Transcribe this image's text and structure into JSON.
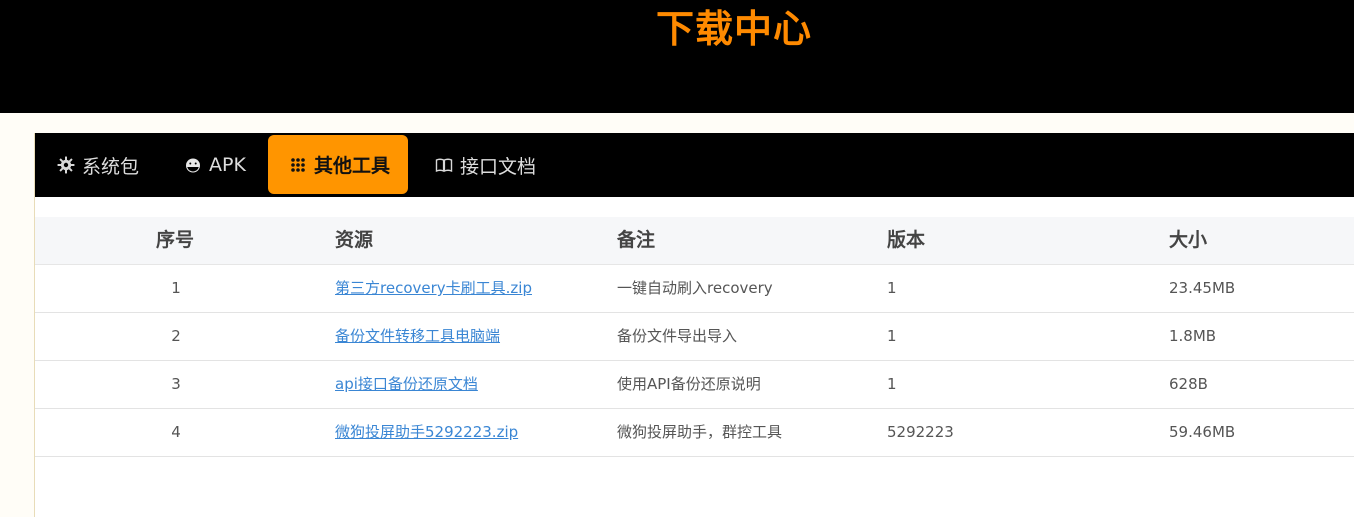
{
  "header": {
    "title": "下载中心"
  },
  "tabs": [
    {
      "label": "系统包",
      "icon": "gear-icon",
      "active": false
    },
    {
      "label": "APK",
      "icon": "android-icon",
      "active": false
    },
    {
      "label": "其他工具",
      "icon": "grid-dots-icon",
      "active": true
    },
    {
      "label": "接口文档",
      "icon": "book-icon",
      "active": false
    }
  ],
  "colors": {
    "accent": "#ff9500",
    "title": "#ff8a00",
    "link": "#3a86d4",
    "header_bg": "#000000"
  },
  "table": {
    "columns": [
      "序号",
      "资源",
      "备注",
      "版本",
      "大小"
    ],
    "rows": [
      {
        "index": "1",
        "resource": "第三方recovery卡刷工具.zip",
        "note": "一键自动刷入recovery",
        "version": "1",
        "size": "23.45MB"
      },
      {
        "index": "2",
        "resource": "备份文件转移工具电脑端",
        "note": "备份文件导出导入",
        "version": "1",
        "size": "1.8MB"
      },
      {
        "index": "3",
        "resource": "api接口备份还原文档",
        "note": "使用API备份还原说明",
        "version": "1",
        "size": "628B"
      },
      {
        "index": "4",
        "resource": "微狗投屏助手5292223.zip",
        "note": "微狗投屏助手，群控工具",
        "version": "5292223",
        "size": "59.46MB"
      }
    ]
  }
}
